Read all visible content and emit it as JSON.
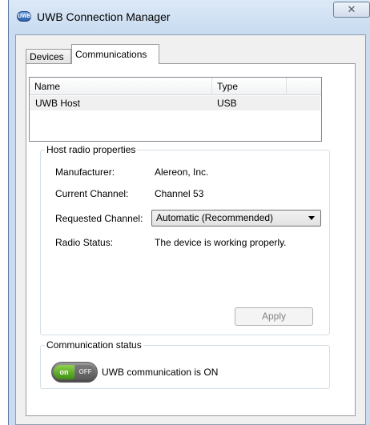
{
  "window": {
    "title": "UWB Connection Manager",
    "icon": "uwb-app-icon",
    "icon_text": "UWB",
    "close_glyph": "✕"
  },
  "tabs": [
    {
      "label": "Devices",
      "active": false
    },
    {
      "label": "Communications",
      "active": true
    }
  ],
  "device_list": {
    "columns": [
      "Name",
      "Type"
    ],
    "rows": [
      {
        "name": "UWB Host",
        "type": "USB"
      }
    ]
  },
  "host_radio": {
    "group_label": "Host radio properties",
    "manufacturer_label": "Manufacturer:",
    "manufacturer_value": "Alereon, Inc.",
    "current_channel_label": "Current Channel:",
    "current_channel_value": "Channel 53",
    "requested_channel_label": "Requested Channel:",
    "requested_channel_value": "Automatic (Recommended)",
    "radio_status_label": "Radio Status:",
    "radio_status_value": "The device is working properly.",
    "apply_label": "Apply"
  },
  "communication": {
    "group_label": "Communication status",
    "toggle_on_label": "on",
    "toggle_off_label": "OFF",
    "toggle_state": "on",
    "status_text": "UWB communication is ON"
  },
  "colors": {
    "accent_on": "#3e8e12",
    "titlebar": "#c8dbf0"
  }
}
